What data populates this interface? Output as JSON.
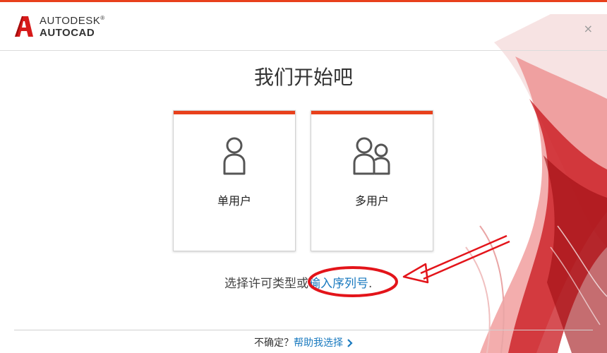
{
  "header": {
    "brand_line1": "AUTODESK",
    "brand_line2": "AUTOCAD",
    "trademark": "®",
    "close_symbol": "×"
  },
  "main": {
    "title": "我们开始吧",
    "cards": [
      {
        "id": "single-user",
        "label": "单用户",
        "icon": "person-icon"
      },
      {
        "id": "multi-user",
        "label": "多用户",
        "icon": "people-icon"
      }
    ],
    "choose_prefix": "选择许可类型或",
    "serial_link": "输入序列号",
    "choose_suffix": "."
  },
  "footer": {
    "unsure_text": "不确定？",
    "help_link": "帮助我选择"
  },
  "colors": {
    "accent": "#e8401c",
    "link": "#1a7abf",
    "annotation": "#e3141a"
  }
}
